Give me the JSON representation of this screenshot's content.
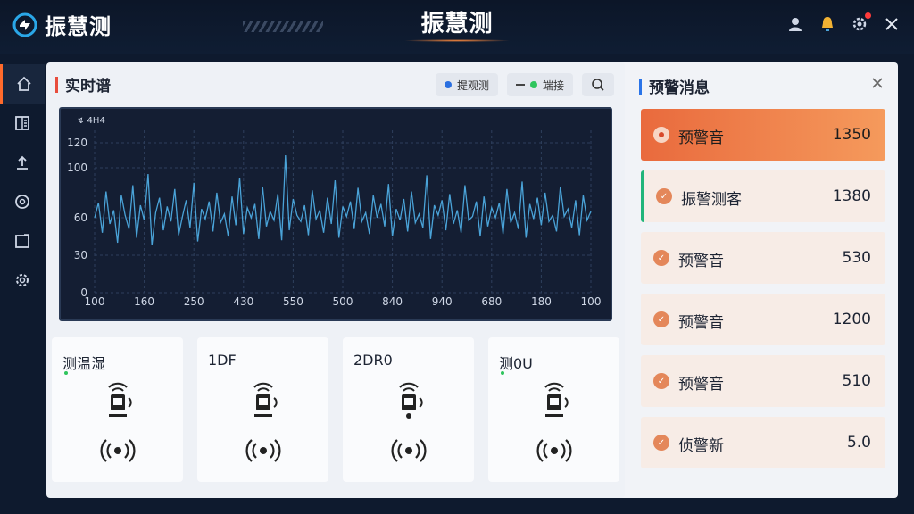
{
  "brand": {
    "name": "振慧测"
  },
  "header": {
    "title": "振慧测"
  },
  "main": {
    "title": "实时谱",
    "chips": [
      {
        "label": "提观测",
        "dot_color": "#2a6fe0"
      },
      {
        "label": "端接",
        "dot_color": "#2fc55d"
      }
    ]
  },
  "chart_data": {
    "type": "line",
    "title": "",
    "legend_text": "↯ 4H4",
    "xlabel": "",
    "ylabel": "",
    "x_tick_labels": [
      "100",
      "160",
      "250",
      "430",
      "550",
      "500",
      "840",
      "940",
      "680",
      "180",
      "100"
    ],
    "y_ticks": [
      0,
      30,
      60,
      100,
      120
    ],
    "y_tick_labels": [
      "0",
      "30",
      "60",
      "100",
      "120"
    ],
    "ylim": [
      0,
      130
    ],
    "grid": true,
    "series": [
      {
        "values": [
          60,
          72,
          48,
          81,
          55,
          66,
          40,
          78,
          62,
          51,
          86,
          44,
          70,
          58,
          95,
          38,
          64,
          76,
          50,
          69,
          57,
          83,
          46,
          61,
          74,
          52,
          88,
          41,
          67,
          59,
          73,
          49,
          80,
          56,
          63,
          45,
          77,
          54,
          92,
          47,
          68,
          60,
          71,
          43,
          85,
          53,
          65,
          58,
          79,
          42,
          110,
          50,
          75,
          62,
          57,
          70,
          46,
          82,
          59,
          66,
          48,
          76,
          55,
          90,
          44,
          69,
          61,
          73,
          51,
          84,
          57,
          64,
          47,
          78,
          60,
          71,
          53,
          87,
          45,
          67,
          58,
          75,
          49,
          81,
          56,
          63,
          52,
          94,
          43,
          70,
          62,
          74,
          50,
          79,
          55,
          66,
          48,
          86,
          58,
          61,
          73,
          45,
          77,
          53,
          68,
          60,
          72,
          47,
          83,
          56,
          64,
          51,
          89,
          44,
          71,
          59,
          76,
          54,
          80,
          57,
          62,
          49,
          85,
          61,
          67,
          52,
          74,
          46,
          78,
          58,
          65
        ]
      }
    ]
  },
  "sensors": [
    {
      "name": "测温湿"
    },
    {
      "name": "1DF"
    },
    {
      "name": "2DR0"
    },
    {
      "name": "测0U"
    }
  ],
  "right": {
    "title": "预警消息",
    "alerts": [
      {
        "name": "预警音",
        "value": "1350"
      },
      {
        "name": "振警测客",
        "value": "1380"
      },
      {
        "name": "预警音",
        "value": "530"
      },
      {
        "name": "预警音",
        "value": "1200"
      },
      {
        "name": "预警音",
        "value": "510"
      },
      {
        "name": "侦警新",
        "value": "5.0"
      }
    ]
  },
  "colors": {
    "accent": "#e96a3d",
    "chart_line": "#4aa3d8",
    "bg": "#0e1a2e"
  }
}
